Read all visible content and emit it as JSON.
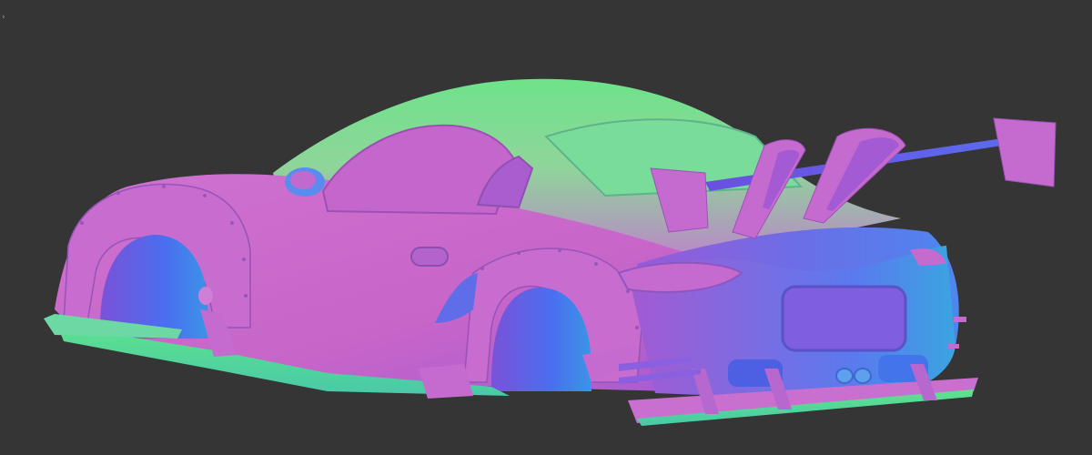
{
  "viewport": {
    "background_color": "#353535",
    "shading": "normal-map",
    "toggle_glyph": "›"
  },
  "subject": {
    "name": "car-body-model",
    "colors": {
      "pink": "#d56fd0",
      "magenta": "#b85ccd",
      "violet": "#8a5fe0",
      "blue": "#4a78f0",
      "cyan": "#3fb8d8",
      "green": "#55e08a",
      "lime": "#8be37a"
    }
  }
}
